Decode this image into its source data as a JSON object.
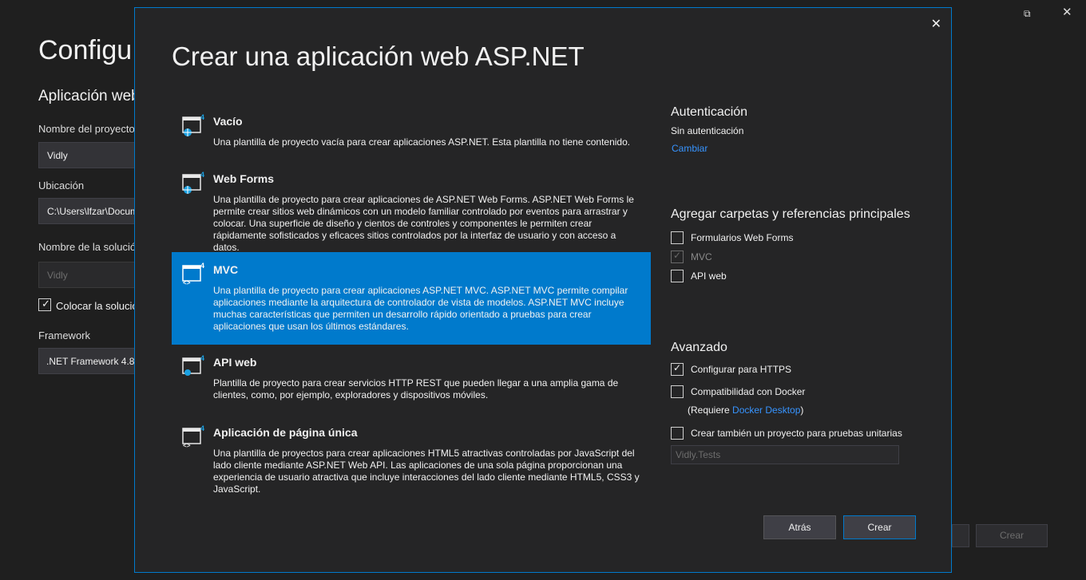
{
  "background": {
    "title": "Configu",
    "subtitle": "Aplicación web",
    "project_name_label": "Nombre del proyecto",
    "project_name_value": "Vidly",
    "location_label": "Ubicación",
    "location_value": "C:\\Users\\lfzar\\Docum",
    "solution_name_label": "Nombre de la solución",
    "solution_name_value": "Vidly",
    "place_together_label": "Colocar la solución",
    "framework_label": "Framework",
    "framework_value": ".NET Framework 4.8",
    "create_button": "Crear",
    "restore_glyph": "⧉",
    "close_glyph": "✕"
  },
  "dialog": {
    "title": "Crear una aplicación web ASP.NET",
    "close_glyph": "✕",
    "templates": [
      {
        "name": "Vacío",
        "description": "Una plantilla de proyecto vacía para crear aplicaciones ASP.NET. Esta plantilla no tiene contenido.",
        "icon": "globe-icon",
        "badge": "4"
      },
      {
        "name": "Web Forms",
        "description": "Una plantilla de proyecto para crear aplicaciones de ASP.NET Web Forms. ASP.NET Web Forms le permite crear sitios web dinámicos con un modelo familiar controlado por eventos para arrastrar y colocar. Una superficie de diseño y cientos de controles y componentes le permiten crear rápidamente sofisticados y eficaces sitios controlados por la interfaz de usuario y con acceso a datos.",
        "icon": "globe-icon",
        "badge": "4"
      },
      {
        "name": "MVC",
        "description": "Una plantilla de proyecto para crear aplicaciones ASP.NET MVC. ASP.NET MVC permite compilar aplicaciones mediante la arquitectura de controlador de vista de modelos. ASP.NET MVC incluye muchas características que permiten un desarrollo rápido orientado a pruebas para crear aplicaciones que usan los últimos estándares.",
        "icon": "code-icon",
        "badge": "4",
        "selected": true
      },
      {
        "name": "API web",
        "description": "Plantilla de proyecto para crear servicios HTTP REST que pueden llegar a una amplia gama de clientes, como, por ejemplo, exploradores y dispositivos móviles.",
        "icon": "api-icon",
        "badge": "4"
      },
      {
        "name": "Aplicación de página única",
        "description": "Una plantilla de proyectos para crear aplicaciones HTML5 atractivas controladas por JavaScript del lado cliente mediante ASP.NET Web API. Las aplicaciones de una sola página proporcionan una experiencia de usuario atractiva que incluye interacciones del lado cliente mediante HTML5, CSS3 y JavaScript.",
        "icon": "spa-icon",
        "badge": "4"
      }
    ],
    "auth": {
      "heading": "Autenticación",
      "value": "Sin autenticación",
      "change_link": "Cambiar"
    },
    "folders": {
      "heading": "Agregar carpetas y referencias principales",
      "items": [
        {
          "label": "Formularios Web Forms",
          "checked": false,
          "disabled": false
        },
        {
          "label": "MVC",
          "checked": true,
          "disabled": true
        },
        {
          "label": "API web",
          "checked": false,
          "disabled": false
        }
      ]
    },
    "advanced": {
      "heading": "Avanzado",
      "https_label": "Configurar para HTTPS",
      "docker_label": "Compatibilidad con Docker",
      "docker_note_prefix": "(Requiere ",
      "docker_note_link": "Docker Desktop",
      "docker_note_suffix": ")",
      "unit_test_label": "Crear también un proyecto para pruebas unitarias",
      "unit_test_project": "Vidly.Tests"
    },
    "buttons": {
      "back": "Atrás",
      "create": "Crear"
    }
  },
  "colors": {
    "accent": "#007acc",
    "link": "#3794ff",
    "background": "#1f1f1f",
    "dialog": "#252526"
  }
}
